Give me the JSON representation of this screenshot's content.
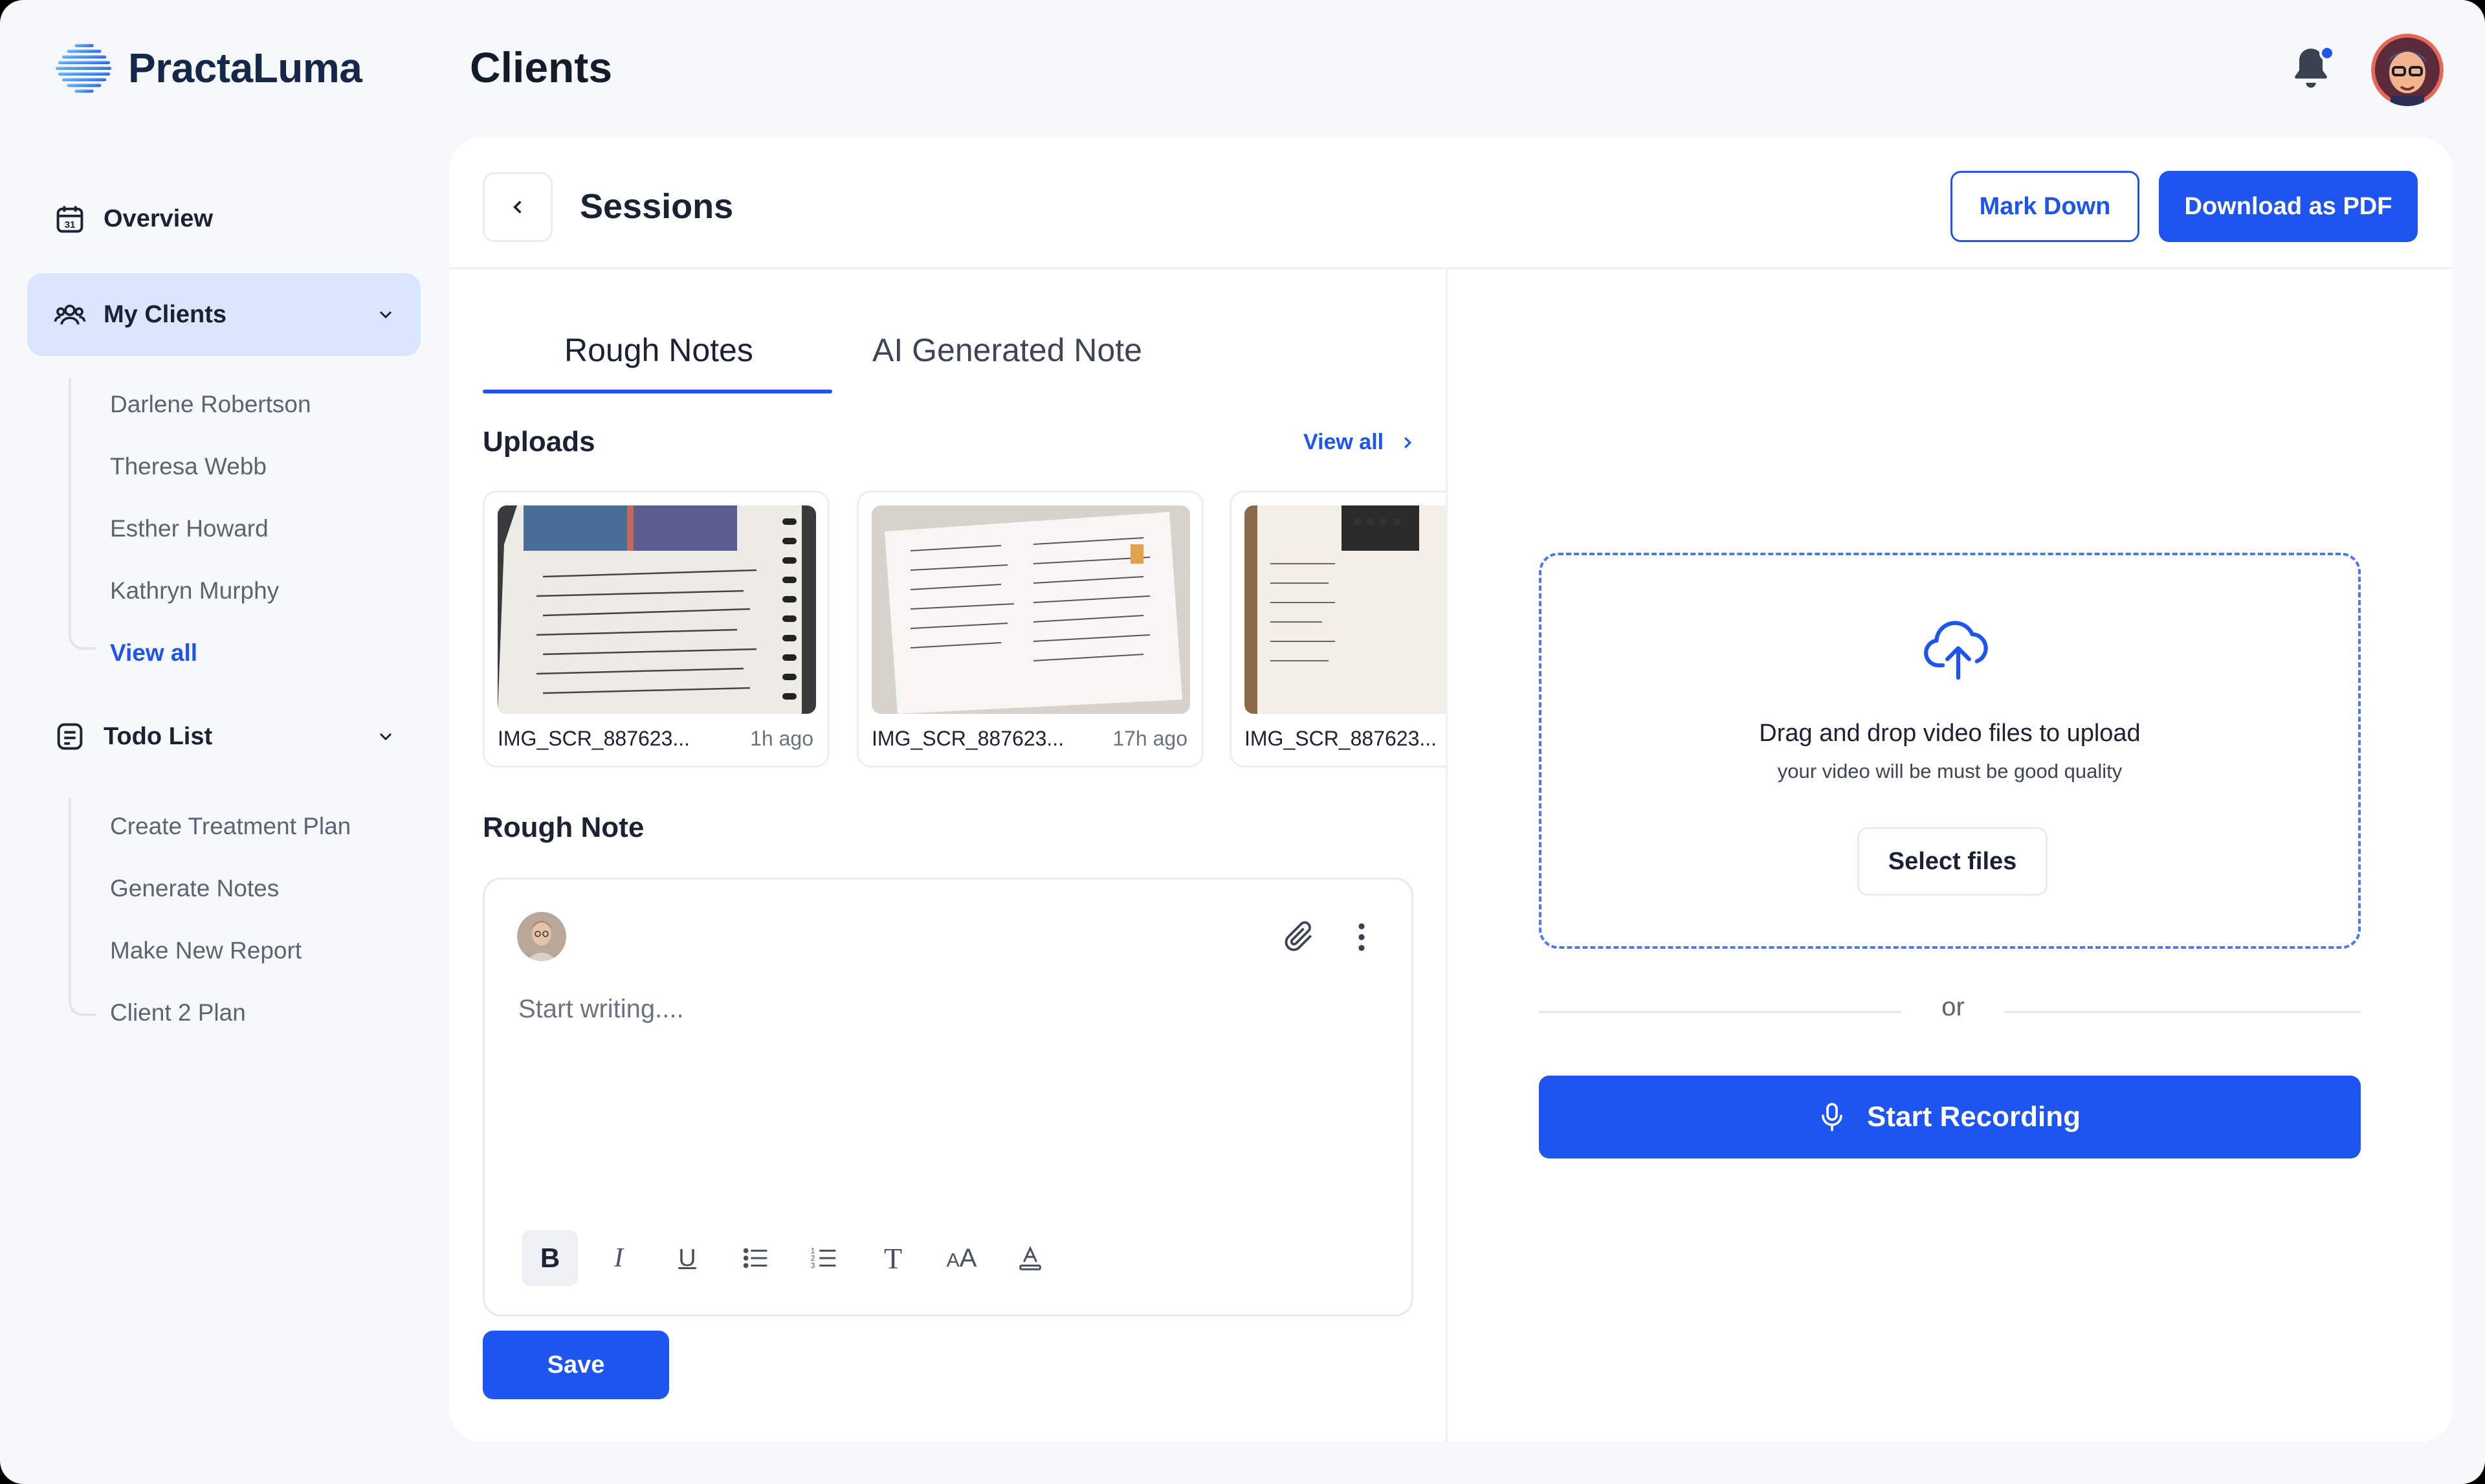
{
  "app": {
    "name": "PractaLuma",
    "page_title": "Clients"
  },
  "colors": {
    "primary": "#1e55f0",
    "sidebar_active_bg": "#d9e6fd",
    "background": "#f7f8fa"
  },
  "header": {
    "notification_icon": "bell-icon",
    "has_unread": true,
    "avatar_icon": "user-avatar"
  },
  "sidebar": {
    "overview": {
      "label": "Overview",
      "icon": "calendar-icon"
    },
    "my_clients": {
      "label": "My Clients",
      "icon": "users-icon",
      "expanded": true,
      "items": [
        "Darlene Robertson",
        "Theresa Webb",
        "Esther Howard",
        "Kathryn Murphy"
      ],
      "view_all": "View all"
    },
    "todo": {
      "label": "Todo List",
      "icon": "list-icon",
      "expanded": true,
      "items": [
        "Create Treatment Plan",
        "Generate Notes",
        "Make New Report",
        "Client 2 Plan"
      ]
    }
  },
  "sessions": {
    "title": "Sessions",
    "mark_down_label": "Mark Down",
    "download_pdf_label": "Download as PDF",
    "tabs": [
      {
        "label": "Rough Notes",
        "active": true
      },
      {
        "label": "AI Generated Note",
        "active": false
      }
    ],
    "uploads": {
      "title": "Uploads",
      "view_all": "View all",
      "files": [
        {
          "name": "IMG_SCR_887623...",
          "time": "1h ago"
        },
        {
          "name": "IMG_SCR_887623...",
          "time": "17h ago"
        },
        {
          "name": "IMG_SCR_887623...",
          "time": ""
        }
      ]
    },
    "rough_note": {
      "title": "Rough Note",
      "placeholder": "Start writing....",
      "toolbar": [
        "bold",
        "italic",
        "underline",
        "bullet-list",
        "numbered-list",
        "text-style",
        "font-size",
        "text-color"
      ],
      "save_label": "Save"
    },
    "upload_panel": {
      "title": "Drag and drop video files to upload",
      "subtitle": "your video will be must be good quality",
      "select_label": "Select files",
      "or_label": "or",
      "record_label": "Start Recording"
    }
  }
}
